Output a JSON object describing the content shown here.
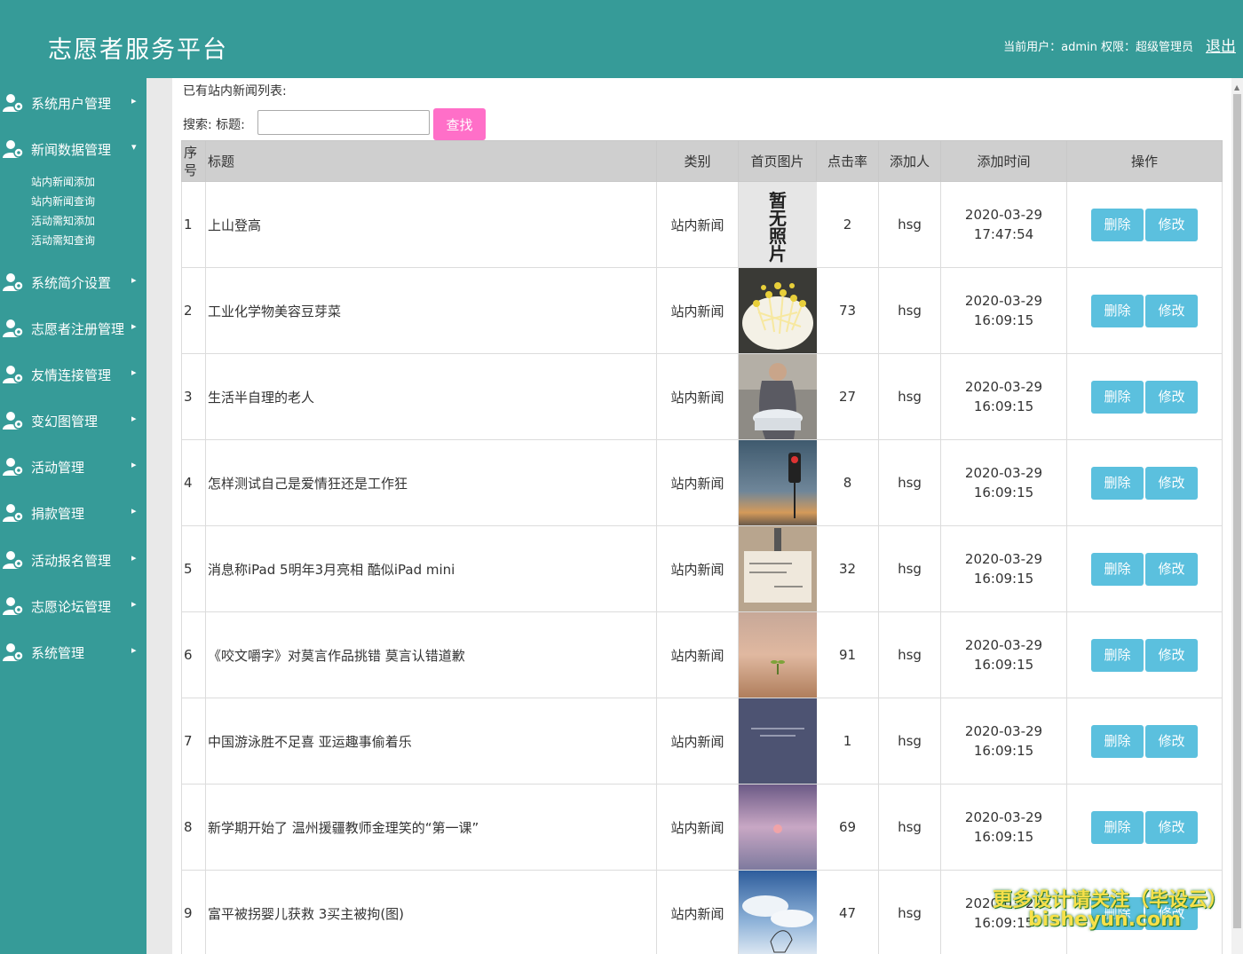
{
  "header": {
    "title": "志愿者服务平台",
    "user_info": "当前用户：admin  权限：超级管理员",
    "logout": "退出"
  },
  "sidebar": {
    "items": [
      {
        "label": "系统用户管理",
        "arrow": "▸"
      },
      {
        "label": "新闻数据管理",
        "arrow": "▾"
      },
      {
        "label": "系统简介设置",
        "arrow": "▸"
      },
      {
        "label": "志愿者注册管理",
        "arrow": "▸"
      },
      {
        "label": "友情连接管理",
        "arrow": "▸"
      },
      {
        "label": "变幻图管理",
        "arrow": "▸"
      },
      {
        "label": "活动管理",
        "arrow": "▸"
      },
      {
        "label": "捐款管理",
        "arrow": "▸"
      },
      {
        "label": "活动报名管理",
        "arrow": "▸"
      },
      {
        "label": "志愿论坛管理",
        "arrow": "▸"
      },
      {
        "label": "系统管理",
        "arrow": "▸"
      }
    ],
    "sub_items": [
      "站内新闻添加",
      "站内新闻查询",
      "活动需知添加",
      "活动需知查询"
    ]
  },
  "main": {
    "list_heading": "已有站内新闻列表:",
    "search_label": "搜索: 标题:",
    "search_value": "",
    "search_button": "查找",
    "columns": [
      "序号",
      "标题",
      "类别",
      "首页图片",
      "点击率",
      "添加人",
      "添加时间",
      "操作"
    ],
    "delete_label": "删除",
    "edit_label": "修改",
    "no_photo_text": "暂无照片",
    "rows": [
      {
        "id": "1",
        "title": "上山登高",
        "category": "站内新闻",
        "image": "no-photo",
        "clicks": "2",
        "author": "hsg",
        "date": "2020-03-29",
        "time": "17:47:54"
      },
      {
        "id": "2",
        "title": "工业化学物美容豆芽菜",
        "category": "站内新闻",
        "image": "bean-sprouts-photo",
        "clicks": "73",
        "author": "hsg",
        "date": "2020-03-29",
        "time": "16:09:15"
      },
      {
        "id": "3",
        "title": "生活半自理的老人",
        "category": "站内新闻",
        "image": "elderly-person-photo",
        "clicks": "27",
        "author": "hsg",
        "date": "2020-03-29",
        "time": "16:09:15"
      },
      {
        "id": "4",
        "title": "怎样测试自己是爱情狂还是工作狂",
        "category": "站内新闻",
        "image": "traffic-light-photo",
        "clicks": "8",
        "author": "hsg",
        "date": "2020-03-29",
        "time": "16:09:15"
      },
      {
        "id": "5",
        "title": "消息称iPad 5明年3月亮相 酷似iPad mini",
        "category": "站内新闻",
        "image": "handwritten-note-photo",
        "clicks": "32",
        "author": "hsg",
        "date": "2020-03-29",
        "time": "16:09:15"
      },
      {
        "id": "6",
        "title": "《咬文嚼字》对莫言作品挑错 莫言认错道歉",
        "category": "站内新闻",
        "image": "sprout-photo",
        "clicks": "91",
        "author": "hsg",
        "date": "2020-03-29",
        "time": "16:09:15"
      },
      {
        "id": "7",
        "title": "中国游泳胜不足喜 亚运趣事偷着乐",
        "category": "站内新闻",
        "image": "text-card-photo",
        "clicks": "1",
        "author": "hsg",
        "date": "2020-03-29",
        "time": "16:09:15"
      },
      {
        "id": "8",
        "title": "新学期开始了 温州援疆教师金理笑的“第一课”",
        "category": "站内新闻",
        "image": "moon-sky-photo",
        "clicks": "69",
        "author": "hsg",
        "date": "2020-03-29",
        "time": "16:09:15"
      },
      {
        "id": "9",
        "title": "富平被拐婴儿获救 3买主被拘(图)",
        "category": "站内新闻",
        "image": "sky-drawing-photo",
        "clicks": "47",
        "author": "hsg",
        "date": "2020-03-29",
        "time": "16:09:15"
      }
    ]
  },
  "watermark": {
    "line1": "更多设计请关注（毕设云）",
    "line2": "bisheyun.com"
  },
  "colors": {
    "header_bg": "#369b98",
    "search_button": "#ff6fc8",
    "action_button": "#5bc0de"
  }
}
